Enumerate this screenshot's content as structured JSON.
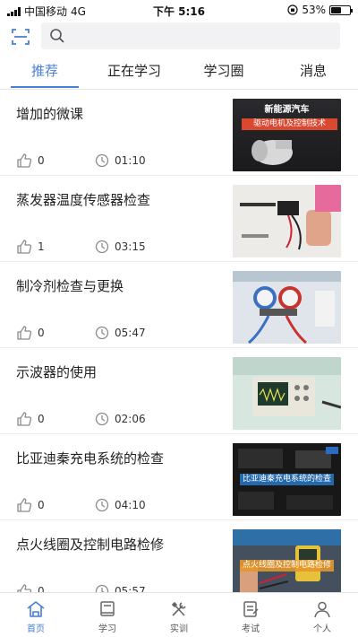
{
  "status_bar": {
    "carrier": "中国移动",
    "network": "4G",
    "time": "下午 5:16",
    "battery": "53%",
    "battery_level": 0.53
  },
  "search": {
    "placeholder": "",
    "value": ""
  },
  "tabs": [
    {
      "label": "推荐",
      "active": true
    },
    {
      "label": "正在学习",
      "active": false
    },
    {
      "label": "学习圈",
      "active": false
    },
    {
      "label": "消息",
      "active": false
    }
  ],
  "lessons": [
    {
      "title": "增加的微课",
      "likes": "0",
      "duration": "01:10",
      "thumb_text": [
        "新能源汽车",
        "驱动电机及控制技术"
      ]
    },
    {
      "title": "蒸发器温度传感器检查",
      "likes": "1",
      "duration": "03:15"
    },
    {
      "title": "制冷剂检查与更换",
      "likes": "0",
      "duration": "05:47"
    },
    {
      "title": "示波器的使用",
      "likes": "0",
      "duration": "02:06"
    },
    {
      "title": "比亚迪秦充电系统的检查",
      "likes": "0",
      "duration": "04:10",
      "thumb_text": [
        "比亚迪秦充电系统的检查"
      ]
    },
    {
      "title": "点火线圈及控制电路检修",
      "likes": "0",
      "duration": "05:57",
      "thumb_text": [
        "点火线圈及控制电路检修"
      ]
    }
  ],
  "bottom_nav": [
    {
      "label": "首页",
      "icon": "home-icon",
      "active": true
    },
    {
      "label": "学习",
      "icon": "book-icon",
      "active": false
    },
    {
      "label": "实训",
      "icon": "tools-icon",
      "active": false
    },
    {
      "label": "考试",
      "icon": "exam-icon",
      "active": false
    },
    {
      "label": "个人",
      "icon": "person-icon",
      "active": false
    }
  ],
  "colors": {
    "accent": "#4a7fd4",
    "text": "#222222",
    "icon_gray": "#8a8a8a"
  }
}
